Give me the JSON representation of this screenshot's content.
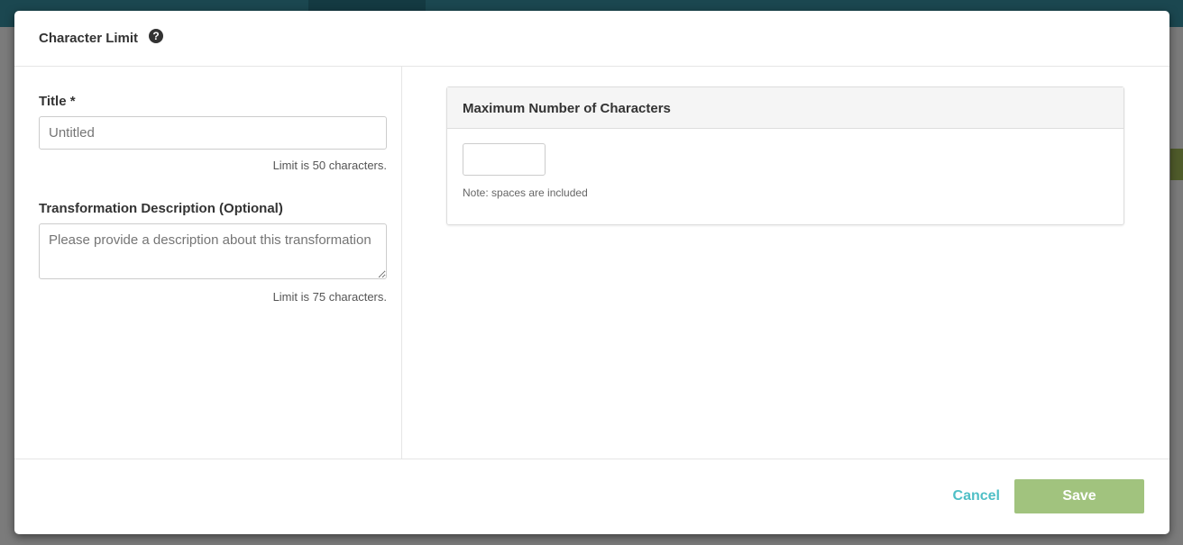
{
  "modal": {
    "title": "Character Limit",
    "help_icon": "question-circle-icon",
    "help_glyph": "?",
    "title_field": {
      "label": "Title *",
      "placeholder": "Untitled",
      "value": "",
      "hint": "Limit is 50 characters."
    },
    "description_field": {
      "label": "Transformation Description (Optional)",
      "placeholder": "Please provide a description about this transformation",
      "value": "",
      "hint": "Limit is 75 characters."
    },
    "panel": {
      "title": "Maximum Number of Characters",
      "value": "",
      "note": "Note: spaces are included"
    },
    "cancel_label": "Cancel",
    "save_label": "Save"
  },
  "colors": {
    "accent": "#4fbfc6",
    "save": "#a1c37e",
    "nav": "#1b4750"
  }
}
